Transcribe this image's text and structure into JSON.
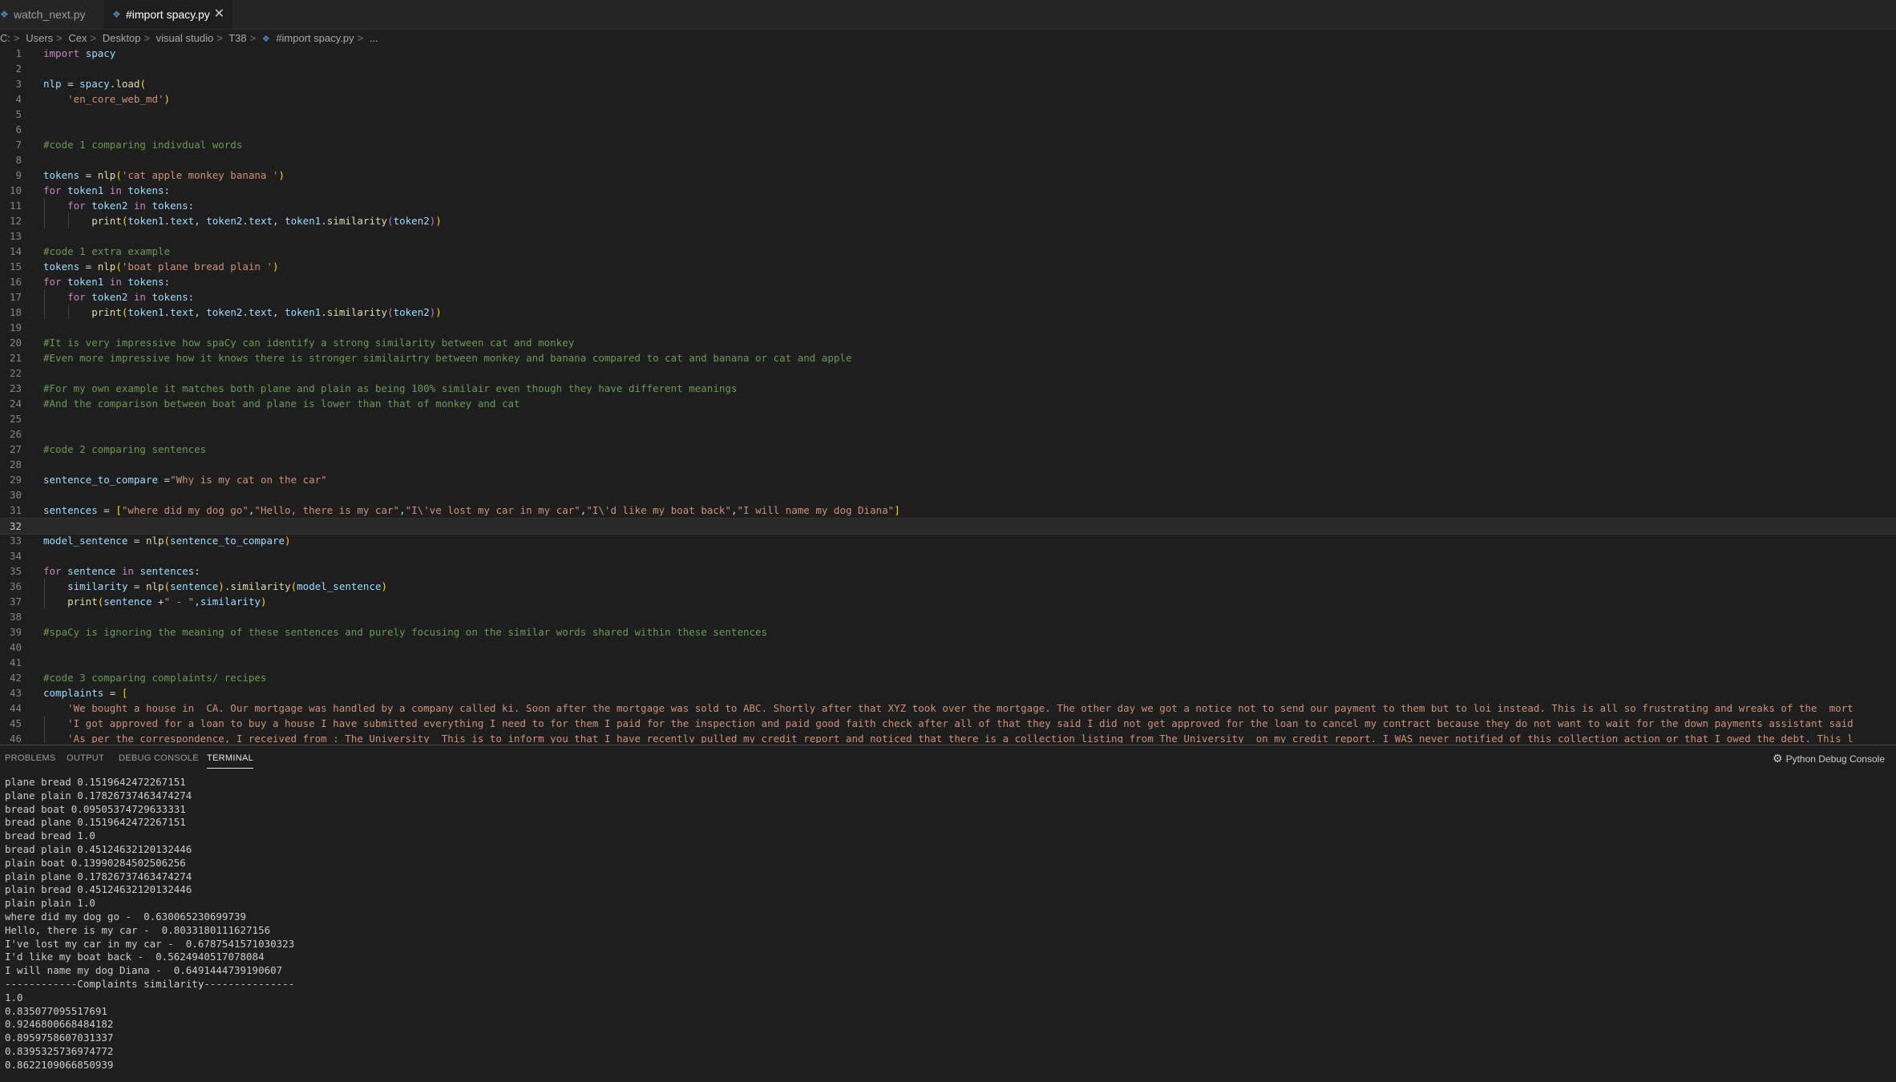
{
  "tabs": [
    {
      "label": "watch_next.py",
      "active": false
    },
    {
      "label": "#import spacy.py",
      "active": true
    }
  ],
  "breadcrumb": [
    "C:",
    "Users",
    "Cex",
    "Desktop",
    "visual studio",
    "T38",
    "#import spacy.py",
    "..."
  ],
  "editor": {
    "lines": [
      {
        "n": "1",
        "t": [
          [
            "k",
            "import"
          ],
          [
            "p",
            " "
          ],
          [
            "v",
            "spacy"
          ]
        ]
      },
      {
        "n": "2",
        "t": []
      },
      {
        "n": "3",
        "t": [
          [
            "v",
            "nlp"
          ],
          [
            "p",
            " = "
          ],
          [
            "v",
            "spacy"
          ],
          [
            "p",
            "."
          ],
          [
            "f",
            "load"
          ],
          [
            "y",
            "("
          ]
        ]
      },
      {
        "n": "4",
        "t": [
          [
            "p",
            "    "
          ],
          [
            "s",
            "'en_core_web_md'"
          ],
          [
            "y",
            ")"
          ]
        ]
      },
      {
        "n": "5",
        "t": []
      },
      {
        "n": "6",
        "t": []
      },
      {
        "n": "7",
        "t": [
          [
            "c",
            "#code 1 comparing indivdual words"
          ]
        ]
      },
      {
        "n": "8",
        "t": []
      },
      {
        "n": "9",
        "t": [
          [
            "v",
            "tokens"
          ],
          [
            "p",
            " = "
          ],
          [
            "f",
            "nlp"
          ],
          [
            "y",
            "("
          ],
          [
            "s",
            "'cat apple monkey banana '"
          ],
          [
            "y",
            ")"
          ]
        ]
      },
      {
        "n": "10",
        "t": [
          [
            "k",
            "for"
          ],
          [
            "p",
            " "
          ],
          [
            "v",
            "token1"
          ],
          [
            "p",
            " "
          ],
          [
            "k",
            "in"
          ],
          [
            "p",
            " "
          ],
          [
            "v",
            "tokens"
          ],
          [
            "p",
            ":"
          ]
        ]
      },
      {
        "n": "11",
        "t": [
          [
            "p",
            "    "
          ],
          [
            "k",
            "for"
          ],
          [
            "p",
            " "
          ],
          [
            "v",
            "token2"
          ],
          [
            "p",
            " "
          ],
          [
            "k",
            "in"
          ],
          [
            "p",
            " "
          ],
          [
            "v",
            "tokens"
          ],
          [
            "p",
            ":"
          ]
        ]
      },
      {
        "n": "12",
        "t": [
          [
            "p",
            "        "
          ],
          [
            "f",
            "print"
          ],
          [
            "y",
            "("
          ],
          [
            "v",
            "token1"
          ],
          [
            "p",
            "."
          ],
          [
            "v",
            "text"
          ],
          [
            "p",
            ", "
          ],
          [
            "v",
            "token2"
          ],
          [
            "p",
            "."
          ],
          [
            "v",
            "text"
          ],
          [
            "p",
            ", "
          ],
          [
            "v",
            "token1"
          ],
          [
            "p",
            "."
          ],
          [
            "f",
            "similarity"
          ],
          [
            "m",
            "("
          ],
          [
            "v",
            "token2"
          ],
          [
            "m",
            ")"
          ],
          [
            "y",
            ")"
          ]
        ]
      },
      {
        "n": "13",
        "t": []
      },
      {
        "n": "14",
        "t": [
          [
            "c",
            "#code 1 extra example"
          ]
        ]
      },
      {
        "n": "15",
        "t": [
          [
            "v",
            "tokens"
          ],
          [
            "p",
            " = "
          ],
          [
            "f",
            "nlp"
          ],
          [
            "y",
            "("
          ],
          [
            "s",
            "'boat plane bread plain '"
          ],
          [
            "y",
            ")"
          ]
        ]
      },
      {
        "n": "16",
        "t": [
          [
            "k",
            "for"
          ],
          [
            "p",
            " "
          ],
          [
            "v",
            "token1"
          ],
          [
            "p",
            " "
          ],
          [
            "k",
            "in"
          ],
          [
            "p",
            " "
          ],
          [
            "v",
            "tokens"
          ],
          [
            "p",
            ":"
          ]
        ]
      },
      {
        "n": "17",
        "t": [
          [
            "p",
            "    "
          ],
          [
            "k",
            "for"
          ],
          [
            "p",
            " "
          ],
          [
            "v",
            "token2"
          ],
          [
            "p",
            " "
          ],
          [
            "k",
            "in"
          ],
          [
            "p",
            " "
          ],
          [
            "v",
            "tokens"
          ],
          [
            "p",
            ":"
          ]
        ]
      },
      {
        "n": "18",
        "t": [
          [
            "p",
            "        "
          ],
          [
            "f",
            "print"
          ],
          [
            "y",
            "("
          ],
          [
            "v",
            "token1"
          ],
          [
            "p",
            "."
          ],
          [
            "v",
            "text"
          ],
          [
            "p",
            ", "
          ],
          [
            "v",
            "token2"
          ],
          [
            "p",
            "."
          ],
          [
            "v",
            "text"
          ],
          [
            "p",
            ", "
          ],
          [
            "v",
            "token1"
          ],
          [
            "p",
            "."
          ],
          [
            "f",
            "similarity"
          ],
          [
            "m",
            "("
          ],
          [
            "v",
            "token2"
          ],
          [
            "m",
            ")"
          ],
          [
            "y",
            ")"
          ]
        ]
      },
      {
        "n": "19",
        "t": []
      },
      {
        "n": "20",
        "t": [
          [
            "c",
            "#It is very impressive how spaCy can identify a strong similarity between cat and monkey"
          ]
        ]
      },
      {
        "n": "21",
        "t": [
          [
            "c",
            "#Even more impressive how it knows there is stronger similairtry between monkey and banana compared to cat and banana or cat and apple"
          ]
        ]
      },
      {
        "n": "22",
        "t": []
      },
      {
        "n": "23",
        "t": [
          [
            "c",
            "#For my own example it matches both plane and plain as being 100% similair even though they have different meanings"
          ]
        ]
      },
      {
        "n": "24",
        "t": [
          [
            "c",
            "#And the comparison between boat and plane is lower than that of monkey and cat"
          ]
        ]
      },
      {
        "n": "25",
        "t": []
      },
      {
        "n": "26",
        "t": []
      },
      {
        "n": "27",
        "t": [
          [
            "c",
            "#code 2 comparing sentences"
          ]
        ]
      },
      {
        "n": "28",
        "t": []
      },
      {
        "n": "29",
        "t": [
          [
            "v",
            "sentence_to_compare"
          ],
          [
            "p",
            " ="
          ],
          [
            "s",
            "\"Why is my cat on the car\""
          ]
        ]
      },
      {
        "n": "30",
        "t": []
      },
      {
        "n": "31",
        "t": [
          [
            "v",
            "sentences"
          ],
          [
            "p",
            " = "
          ],
          [
            "y",
            "["
          ],
          [
            "s",
            "\"where did my dog go\""
          ],
          [
            "p",
            ","
          ],
          [
            "s",
            "\"Hello, there is my car\""
          ],
          [
            "p",
            ","
          ],
          [
            "s",
            "\"I\\'ve lost my car in my car\""
          ],
          [
            "p",
            ","
          ],
          [
            "s",
            "\"I\\'d like my boat back\""
          ],
          [
            "p",
            ","
          ],
          [
            "s",
            "\"I will name my dog Diana\""
          ],
          [
            "y",
            "]"
          ]
        ]
      },
      {
        "n": "32",
        "t": [],
        "current": true
      },
      {
        "n": "33",
        "t": [
          [
            "v",
            "model_sentence"
          ],
          [
            "p",
            " = "
          ],
          [
            "f",
            "nlp"
          ],
          [
            "y",
            "("
          ],
          [
            "v",
            "sentence_to_compare"
          ],
          [
            "y",
            ")"
          ]
        ]
      },
      {
        "n": "34",
        "t": []
      },
      {
        "n": "35",
        "t": [
          [
            "k",
            "for"
          ],
          [
            "p",
            " "
          ],
          [
            "v",
            "sentence"
          ],
          [
            "p",
            " "
          ],
          [
            "k",
            "in"
          ],
          [
            "p",
            " "
          ],
          [
            "v",
            "sentences"
          ],
          [
            "p",
            ":"
          ]
        ]
      },
      {
        "n": "36",
        "t": [
          [
            "p",
            "    "
          ],
          [
            "v",
            "similarity"
          ],
          [
            "p",
            " = "
          ],
          [
            "f",
            "nlp"
          ],
          [
            "y",
            "("
          ],
          [
            "v",
            "sentence"
          ],
          [
            "y",
            ")"
          ],
          [
            "p",
            "."
          ],
          [
            "f",
            "similarity"
          ],
          [
            "y",
            "("
          ],
          [
            "v",
            "model_sentence"
          ],
          [
            "y",
            ")"
          ]
        ]
      },
      {
        "n": "37",
        "t": [
          [
            "p",
            "    "
          ],
          [
            "f",
            "print"
          ],
          [
            "y",
            "("
          ],
          [
            "v",
            "sentence"
          ],
          [
            "p",
            " +"
          ],
          [
            "s",
            "\" - \""
          ],
          [
            "p",
            ","
          ],
          [
            "v",
            "similarity"
          ],
          [
            "y",
            ")"
          ]
        ]
      },
      {
        "n": "38",
        "t": []
      },
      {
        "n": "39",
        "t": [
          [
            "c",
            "#spaCy is ignoring the meaning of these sentences and purely focusing on the similar words shared within these sentences"
          ]
        ]
      },
      {
        "n": "40",
        "t": []
      },
      {
        "n": "41",
        "t": []
      },
      {
        "n": "42",
        "t": [
          [
            "c",
            "#code 3 comparing complaints/ recipes"
          ]
        ]
      },
      {
        "n": "43",
        "t": [
          [
            "v",
            "complaints"
          ],
          [
            "p",
            " = "
          ],
          [
            "y",
            "["
          ]
        ]
      },
      {
        "n": "44",
        "t": [
          [
            "p",
            "    "
          ],
          [
            "s",
            "'We bought a house in  CA. Our mortgage was handled by a company called ki. Soon after the mortgage was sold to ABC. Shortly after that XYZ took over the mortgage. The other day we got a notice not to send our payment to them but to loi instead. This is all so frustrating and wreaks of the  mort"
          ]
        ]
      },
      {
        "n": "45",
        "t": [
          [
            "p",
            "    "
          ],
          [
            "s",
            "'I got approved for a loan to buy a house I have submitted everything I need to for them I paid for the inspection and paid good faith check after all of that they said I did not get approved for the loan to cancel my contract because they do not want to wait for the down payments assistant said"
          ]
        ]
      },
      {
        "n": "46",
        "t": [
          [
            "p",
            "    "
          ],
          [
            "s",
            "'As per the correspondence, I received from : The University  This is to inform you that I have recently pulled my credit report and noticed that there is a collection listing from The University  on my credit report. I WAS never notified of this collection action or that I owed the debt. This l"
          ]
        ]
      }
    ]
  },
  "panel": {
    "tabs": [
      {
        "label": "PROBLEMS",
        "active": false
      },
      {
        "label": "OUTPUT",
        "active": false
      },
      {
        "label": "DEBUG CONSOLE",
        "active": false
      },
      {
        "label": "TERMINAL",
        "active": true
      }
    ],
    "debug_console_label": "Python Debug Console",
    "terminal_lines": [
      "plane bread 0.1519642472267151",
      "plane plain 0.17826737463474274",
      "bread boat 0.09505374729633331",
      "bread plane 0.1519642472267151",
      "bread bread 1.0",
      "bread plain 0.45124632120132446",
      "plain boat 0.13990284502506256",
      "plain plane 0.17826737463474274",
      "plain bread 0.45124632120132446",
      "plain plain 1.0",
      "where did my dog go -  0.630065230699739",
      "Hello, there is my car -  0.8033180111627156",
      "I've lost my car in my car -  0.6787541571030323",
      "I'd like my boat back -  0.5624940517078084",
      "I will name my dog Diana -  0.6491444739190607",
      "------------Complaints similarity---------------",
      "1.0",
      "0.835077095517691",
      "0.9246800668484182",
      "0.8959758607031337",
      "0.8395325736974772",
      "0.8622109066850939"
    ]
  }
}
